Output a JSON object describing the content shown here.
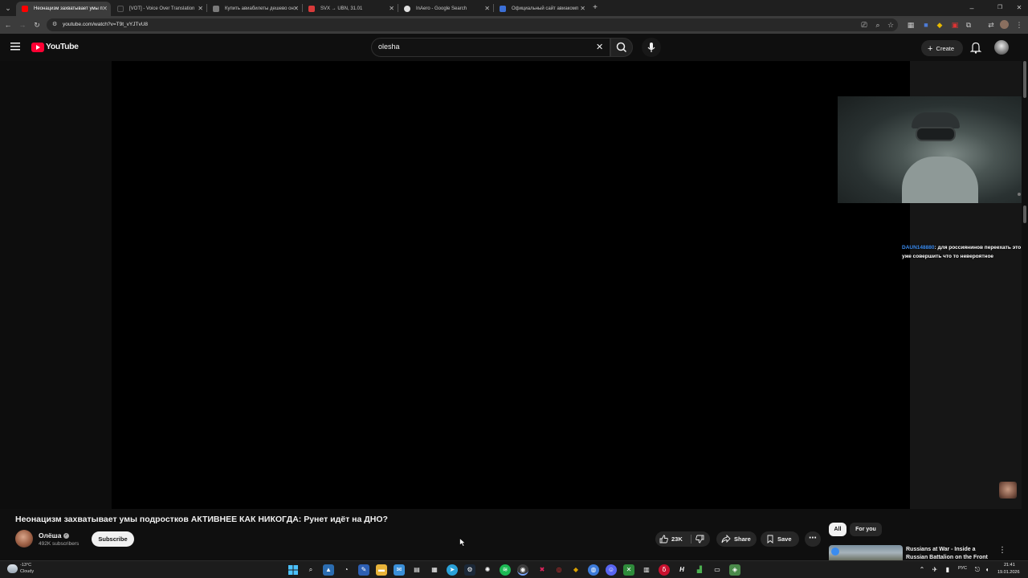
{
  "browser": {
    "tabs": [
      {
        "title": "Неонацизм захватывает умы п",
        "favicon_color": "#ff0000",
        "active": true
      },
      {
        "title": "[VOT] - Voice Over Translation",
        "favicon_color": "#222222",
        "active": false
      },
      {
        "title": "Купить авиабилеты дешево он",
        "favicon_color": "#7a7a7a",
        "active": false
      },
      {
        "title": "SVX → UBN, 31.01",
        "favicon_color": "#d83a3a",
        "active": false
      },
      {
        "title": "InAero - Google Search",
        "favicon_color": "#e0e0e0",
        "active": false
      },
      {
        "title": "Официальный сайт авиакомп",
        "favicon_color": "#3b6fd6",
        "active": false
      }
    ],
    "url": "youtube.com/watch?v=T9t_vYJTvU8"
  },
  "youtube": {
    "logo_text": "YouTube",
    "search_query": "olesha",
    "create_label": "Create"
  },
  "player": {
    "chat_user": "DAUN148880",
    "chat_text": ": для россиянинов переехать это уже совершить что то невероятное"
  },
  "video": {
    "title": "Неонацизм захватывает умы подростков АКТИВНЕЕ КАК НИКОГДА: Рунет идёт на ДНО?",
    "channel_name": "Олёша",
    "subscribers": "492K subscribers",
    "subscribe_label": "Subscribe",
    "likes": "23K",
    "share_label": "Share",
    "save_label": "Save"
  },
  "sidebar": {
    "chips": [
      "All",
      "For you"
    ],
    "recommendation_title": "Russians at War - Inside a Russian Battalion on the Front"
  },
  "taskbar": {
    "weather_temp": "-13°C",
    "weather_desc": "Cloudy",
    "language": "РУС",
    "time": "21:41",
    "date": "19.01.2026"
  },
  "colors": {
    "yt_red": "#ff0033",
    "chat_user": "#3b8cf0",
    "background": "#0f0f0f"
  }
}
